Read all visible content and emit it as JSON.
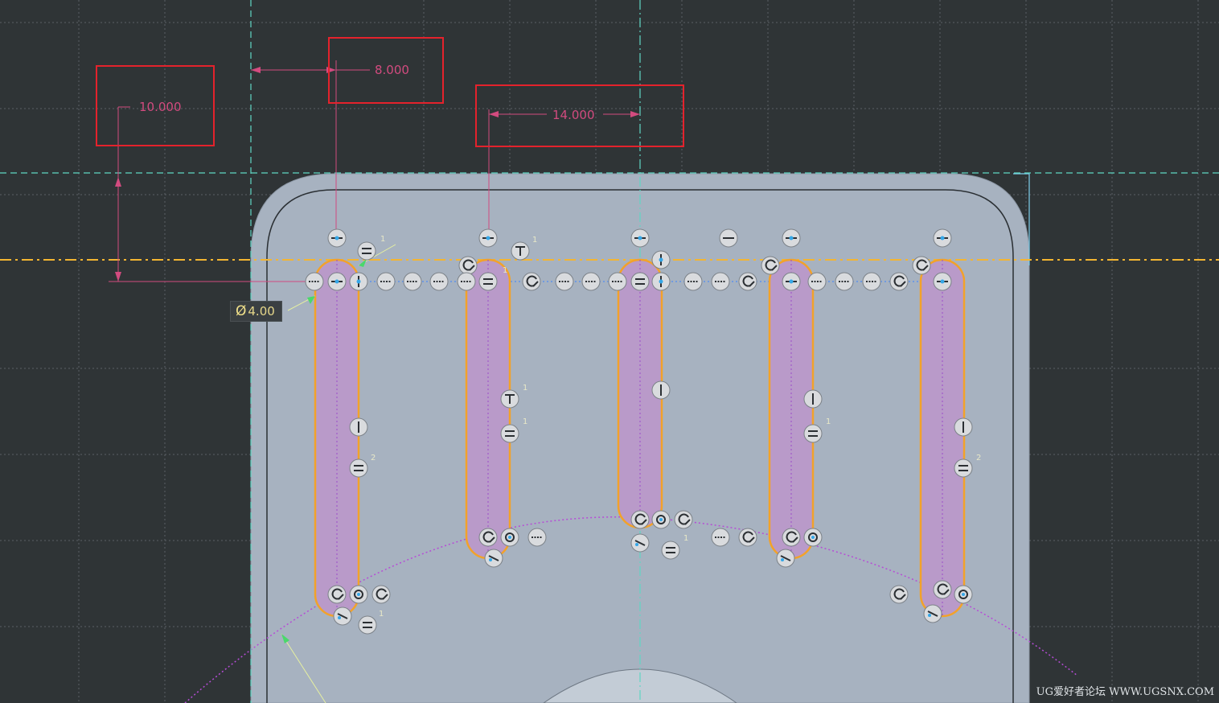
{
  "sketch": {
    "dimensions": [
      {
        "id": "dim-vertical",
        "value": "10.000"
      },
      {
        "id": "dim-horizontal-left",
        "value": "8.000"
      },
      {
        "id": "dim-horizontal-center",
        "value": "14.000"
      }
    ],
    "diameter": {
      "symbol": "Ø",
      "value": "4.00"
    },
    "constraint_icons": [
      "coincident-icon",
      "equal-icon",
      "tangent-icon",
      "parallel-icon",
      "perpendicular-icon",
      "horizontal-icon",
      "vertical-icon",
      "collinear-icon",
      "concentric-icon",
      "point-on-curve-icon"
    ],
    "constraint_counts": [
      "1",
      "1",
      "1",
      "1",
      "1",
      "2",
      "1",
      "1",
      "2",
      "1"
    ]
  },
  "colors": {
    "background": "#2f3436",
    "grid": "#5b6165",
    "part_face": "#a7b2c0",
    "slot_fill": "#b99ac9",
    "slot_outline": "#f2a22a",
    "dimension": "#d24b7f",
    "highlight_box": "#e4222c",
    "centerline": "#5fd6c4",
    "reference_line": "#f4b531",
    "arc": "#b64cd6"
  },
  "watermark": "UG爱好者论坛  WWW.UGSNX.COM"
}
